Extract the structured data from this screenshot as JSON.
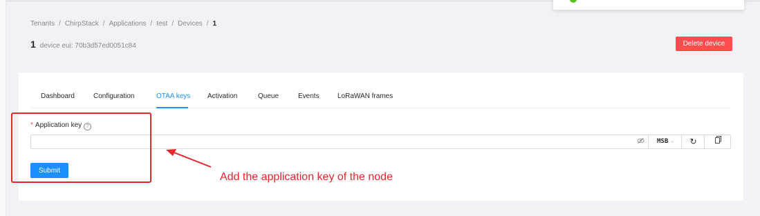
{
  "breadcrumb": {
    "items": [
      "Tenants",
      "ChirpStack",
      "Applications",
      "test",
      "Devices"
    ],
    "separator": "/",
    "current": "1"
  },
  "device": {
    "name": "1",
    "eui_text": "device eui: 70b3d57ed0051c84"
  },
  "actions": {
    "delete_label": "Delete device"
  },
  "tabs": [
    {
      "label": "Dashboard"
    },
    {
      "label": "Configuration"
    },
    {
      "label": "OTAA keys",
      "active": true
    },
    {
      "label": "Activation"
    },
    {
      "label": "Queue"
    },
    {
      "label": "Events"
    },
    {
      "label": "LoRaWAN frames"
    }
  ],
  "form": {
    "required_mark": "*",
    "label": "Application key",
    "help_icon": "question-circle-icon",
    "value": "",
    "byte_order": "MSB",
    "submit_label": "Submit"
  },
  "annotation": {
    "text": "Add the application key of the node"
  },
  "colors": {
    "accent": "#1890ff",
    "danger": "#ff4d4f",
    "annotation": "#e6262b",
    "success": "#52c41a"
  }
}
